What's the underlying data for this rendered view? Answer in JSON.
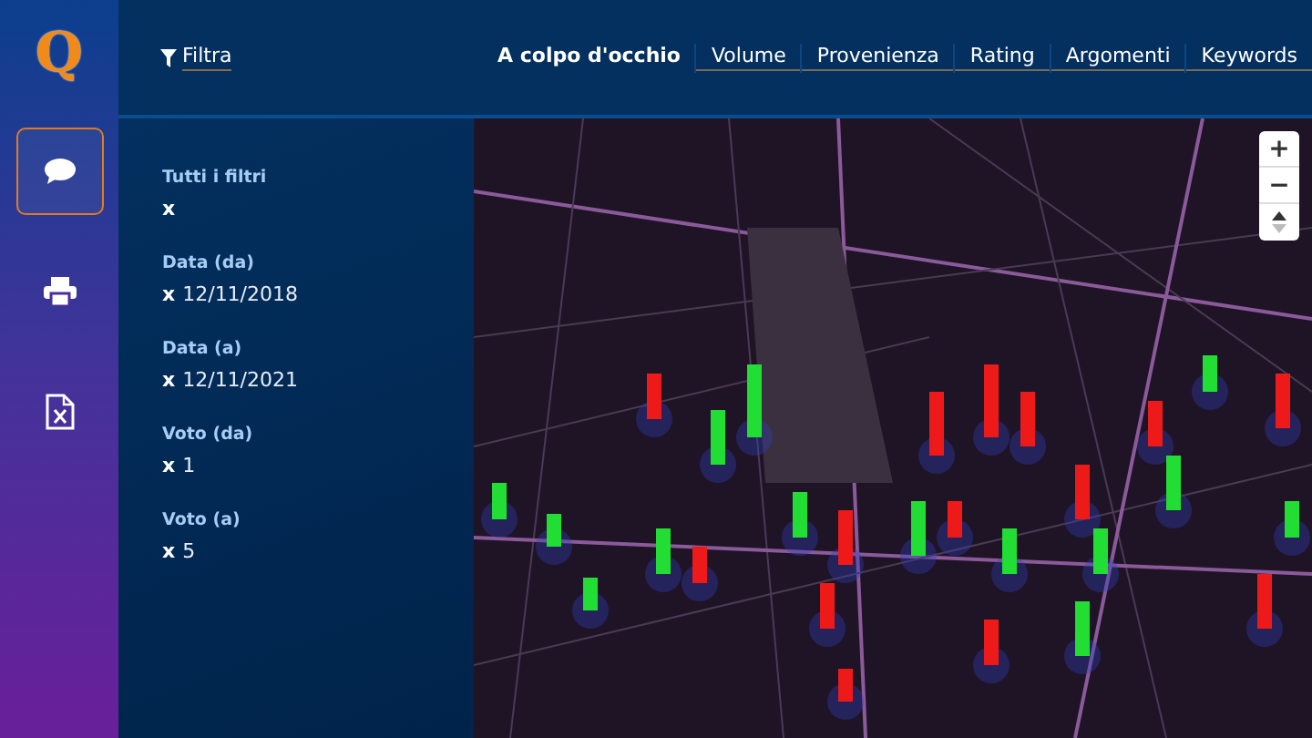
{
  "logo": {
    "text": "Q"
  },
  "sidebar": {
    "items": [
      {
        "kind": "chat",
        "selected": true
      },
      {
        "kind": "print",
        "selected": false
      },
      {
        "kind": "excel",
        "selected": false
      }
    ]
  },
  "filter_button": {
    "label": "Filtra"
  },
  "tabs": [
    {
      "label": "A colpo d'occhio",
      "selected": true
    },
    {
      "label": "Volume",
      "selected": false
    },
    {
      "label": "Provenienza",
      "selected": false
    },
    {
      "label": "Rating",
      "selected": false
    },
    {
      "label": "Argomenti",
      "selected": false
    },
    {
      "label": "Keywords",
      "selected": false
    }
  ],
  "filters": [
    {
      "label": "Tutti i filtri",
      "remove": "x"
    },
    {
      "label": "Data (da)",
      "remove": "x",
      "value": "12/11/2018"
    },
    {
      "label": "Data (a)",
      "remove": "x",
      "value": "12/11/2021"
    },
    {
      "label": "Voto (da)",
      "remove": "x",
      "value": "1"
    },
    {
      "label": "Voto (a)",
      "remove": "x",
      "value": "5"
    }
  ],
  "map": {
    "zoom_in": "+",
    "zoom_out": "−"
  }
}
